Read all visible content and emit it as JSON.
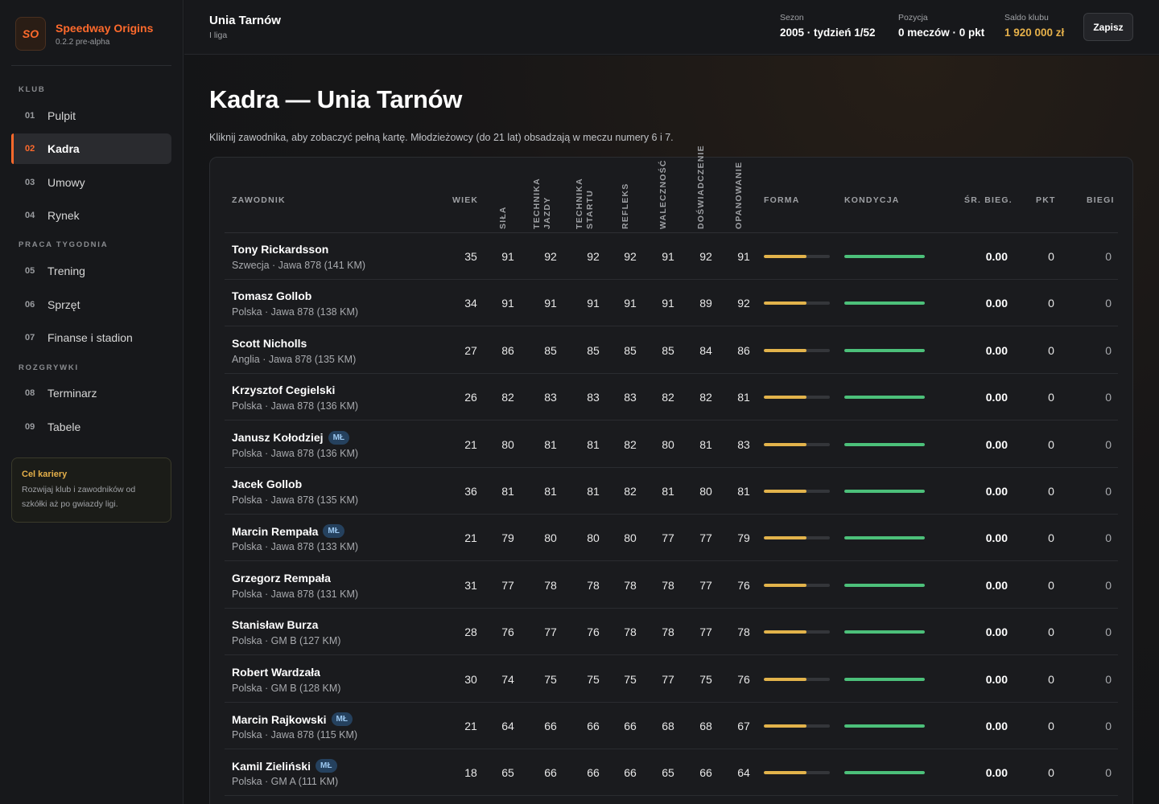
{
  "app": {
    "logo_text": "SO",
    "name": "Speedway Origins",
    "version": "0.2.2 pre-alpha"
  },
  "nav": {
    "sections": [
      "KLUB",
      "PRACA TYGODNIA",
      "ROZGRYWKI"
    ],
    "items": [
      {
        "num": "01",
        "label": "Pulpit"
      },
      {
        "num": "02",
        "label": "Kadra",
        "active": true
      },
      {
        "num": "03",
        "label": "Umowy"
      },
      {
        "num": "04",
        "label": "Rynek"
      },
      {
        "num": "05",
        "label": "Trening"
      },
      {
        "num": "06",
        "label": "Sprzęt"
      },
      {
        "num": "07",
        "label": "Finanse i stadion"
      },
      {
        "num": "08",
        "label": "Terminarz"
      },
      {
        "num": "09",
        "label": "Tabele"
      }
    ]
  },
  "career": {
    "title": "Cel kariery",
    "text": "Rozwijaj klub i zawodników od szkółki aż po gwiazdy ligi."
  },
  "topbar": {
    "club": "Unia Tarnów",
    "league": "I liga",
    "season_label": "Sezon",
    "season_value": "2005 · tydzień 1/52",
    "position_label": "Pozycja",
    "position_value": "0 meczów · 0 pkt",
    "balance_label": "Saldo klubu",
    "balance_value": "1 920 000 zł",
    "save_label": "Zapisz"
  },
  "page": {
    "title": "Kadra — Unia Tarnów",
    "subtitle": "Kliknij zawodnika, aby zobaczyć pełną kartę. Młodzieżowcy (do 21 lat) obsadzają w meczu numery 6 i 7."
  },
  "table": {
    "headers": {
      "player": "ZAWODNIK",
      "age": "WIEK",
      "sila": "SIŁA",
      "tech_jazdy_1": "TECHNIKA",
      "tech_jazdy_2": "JAZDY",
      "tech_startu_1": "TECHNIKA",
      "tech_startu_2": "STARTU",
      "refleks": "REFLEKS",
      "walecznosc": "WALECZNOŚĆ",
      "doswiadczenie": "DOŚWIADCZENIE",
      "opanowanie": "OPANOWANIE",
      "forma": "FORMA",
      "kondycja": "KONDYCJA",
      "avg": "ŚR. BIEG.",
      "pkt": "PKT",
      "biegi": "BIEGI"
    },
    "badge_label": "MŁ",
    "colors": {
      "forma": "#e2b34b",
      "kondycja": "#4cc07a"
    },
    "rows": [
      {
        "name": "Tony Rickardsson",
        "meta": "Szwecja · Jawa 878 (141 KM)",
        "junior": false,
        "age": "35",
        "stats": [
          "91",
          "92",
          "92",
          "92",
          "91",
          "92",
          "91"
        ],
        "forma": 0.65,
        "kondycja": 1.0,
        "avg": "0.00",
        "pkt": "0",
        "biegi": "0"
      },
      {
        "name": "Tomasz Gollob",
        "meta": "Polska · Jawa 878 (138 KM)",
        "junior": false,
        "age": "34",
        "stats": [
          "91",
          "91",
          "91",
          "91",
          "91",
          "89",
          "92"
        ],
        "forma": 0.65,
        "kondycja": 1.0,
        "avg": "0.00",
        "pkt": "0",
        "biegi": "0"
      },
      {
        "name": "Scott Nicholls",
        "meta": "Anglia · Jawa 878 (135 KM)",
        "junior": false,
        "age": "27",
        "stats": [
          "86",
          "85",
          "85",
          "85",
          "85",
          "84",
          "86"
        ],
        "forma": 0.65,
        "kondycja": 1.0,
        "avg": "0.00",
        "pkt": "0",
        "biegi": "0"
      },
      {
        "name": "Krzysztof Cegielski",
        "meta": "Polska · Jawa 878 (136 KM)",
        "junior": false,
        "age": "26",
        "stats": [
          "82",
          "83",
          "83",
          "83",
          "82",
          "82",
          "81"
        ],
        "forma": 0.65,
        "kondycja": 1.0,
        "avg": "0.00",
        "pkt": "0",
        "biegi": "0"
      },
      {
        "name": "Janusz Kołodziej",
        "meta": "Polska · Jawa 878 (136 KM)",
        "junior": true,
        "age": "21",
        "stats": [
          "80",
          "81",
          "81",
          "82",
          "80",
          "81",
          "83"
        ],
        "forma": 0.65,
        "kondycja": 1.0,
        "avg": "0.00",
        "pkt": "0",
        "biegi": "0"
      },
      {
        "name": "Jacek Gollob",
        "meta": "Polska · Jawa 878 (135 KM)",
        "junior": false,
        "age": "36",
        "stats": [
          "81",
          "81",
          "81",
          "82",
          "81",
          "80",
          "81"
        ],
        "forma": 0.65,
        "kondycja": 1.0,
        "avg": "0.00",
        "pkt": "0",
        "biegi": "0"
      },
      {
        "name": "Marcin Rempała",
        "meta": "Polska · Jawa 878 (133 KM)",
        "junior": true,
        "age": "21",
        "stats": [
          "79",
          "80",
          "80",
          "80",
          "77",
          "77",
          "79"
        ],
        "forma": 0.65,
        "kondycja": 1.0,
        "avg": "0.00",
        "pkt": "0",
        "biegi": "0"
      },
      {
        "name": "Grzegorz Rempała",
        "meta": "Polska · Jawa 878 (131 KM)",
        "junior": false,
        "age": "31",
        "stats": [
          "77",
          "78",
          "78",
          "78",
          "78",
          "77",
          "76"
        ],
        "forma": 0.65,
        "kondycja": 1.0,
        "avg": "0.00",
        "pkt": "0",
        "biegi": "0"
      },
      {
        "name": "Stanisław Burza",
        "meta": "Polska · GM B (127 KM)",
        "junior": false,
        "age": "28",
        "stats": [
          "76",
          "77",
          "76",
          "78",
          "78",
          "77",
          "78"
        ],
        "forma": 0.65,
        "kondycja": 1.0,
        "avg": "0.00",
        "pkt": "0",
        "biegi": "0"
      },
      {
        "name": "Robert Wardzała",
        "meta": "Polska · GM B (128 KM)",
        "junior": false,
        "age": "30",
        "stats": [
          "74",
          "75",
          "75",
          "75",
          "77",
          "75",
          "76"
        ],
        "forma": 0.65,
        "kondycja": 1.0,
        "avg": "0.00",
        "pkt": "0",
        "biegi": "0"
      },
      {
        "name": "Marcin Rajkowski",
        "meta": "Polska · Jawa 878 (115 KM)",
        "junior": true,
        "age": "21",
        "stats": [
          "64",
          "66",
          "66",
          "66",
          "68",
          "68",
          "67"
        ],
        "forma": 0.65,
        "kondycja": 1.0,
        "avg": "0.00",
        "pkt": "0",
        "biegi": "0"
      },
      {
        "name": "Kamil Zieliński",
        "meta": "Polska · GM A (111 KM)",
        "junior": true,
        "age": "18",
        "stats": [
          "65",
          "66",
          "66",
          "66",
          "65",
          "66",
          "64"
        ],
        "forma": 0.65,
        "kondycja": 1.0,
        "avg": "0.00",
        "pkt": "0",
        "biegi": "0"
      }
    ]
  }
}
